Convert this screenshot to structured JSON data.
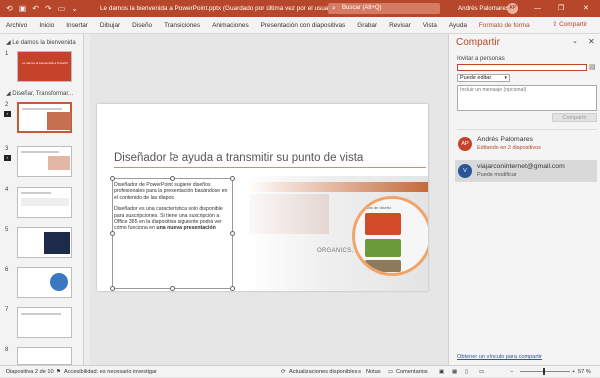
{
  "titlebar": {
    "title": "Le damos la bienvenida a PowerPoint.pptx (Guardado por última vez por el usuario) - PowerPoint",
    "search_placeholder": "Buscar (Alt+Q)",
    "user": "Andrés Palomares",
    "user_initials": "AP",
    "minimize": "—",
    "restore": "❐",
    "close": "✕"
  },
  "ribbon": {
    "tabs": [
      "Archivo",
      "Inicio",
      "Insertar",
      "Dibujar",
      "Diseño",
      "Transiciones",
      "Animaciones",
      "Presentación con diapositivas",
      "Grabar",
      "Revisar",
      "Vista",
      "Ayuda",
      "Formato de forma"
    ],
    "active_tab": "Formato de forma",
    "share_label": "Compartir"
  },
  "thumbnails": {
    "section1": "Le damos la bienvenida",
    "section2": "Diseñar, Transformar...",
    "slide1_text": "Le damos la bienvenida a PowerPoint",
    "numbers": [
      "1",
      "2",
      "3",
      "4",
      "5",
      "6",
      "7",
      "8",
      "9"
    ]
  },
  "slide": {
    "title": "Diseñador le ayuda a transmitir su punto de vista",
    "para1": "Diseñador de PowerPoint sugiere diseños profesionales para la presentación basándose en el contenido de las diapos",
    "para2_start": "Diseñador es una característica solo disponible para suscripciones. Si tiene una suscripción a Office 365 en la diapositiva siguiente podrá ver cómo funciona en ",
    "para2_bold": "una nueva presentación",
    "image_text": "ORGANICS, CO.",
    "panel_label": "Ideas de diseño"
  },
  "share_pane": {
    "title": "Compartir",
    "invite_label": "Invitar a personas",
    "permission": "Puede editar",
    "message_placeholder": "Incluir un mensaje (opcional)",
    "share_button": "Compartir",
    "people": [
      {
        "name": "Andrés Palomares",
        "status": "Editando en 2 dispositivos",
        "initials": "AP",
        "color": "#c5432a",
        "status_color": "#b7472a"
      },
      {
        "name": "viajarconinternet@gmail.com",
        "status": "Puede modificar",
        "initials": "V",
        "color": "#2b579a",
        "status_color": "#555555"
      }
    ],
    "link": "Obtener un vínculo para compartir"
  },
  "statusbar": {
    "slide_info": "Diapositiva 2 de 10",
    "accessibility": "Accesibilidad: es necesario investigar",
    "updates": "Actualizaciones disponibles",
    "notes": "Notas",
    "comments": "Comentarios",
    "zoom": "57 %"
  },
  "colors": {
    "accent": "#b7472a",
    "link": "#2b5797"
  }
}
